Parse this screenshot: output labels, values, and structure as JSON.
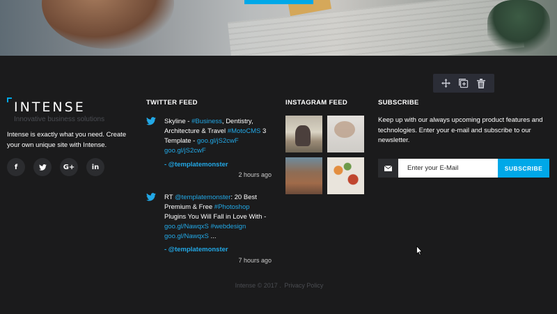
{
  "colors": {
    "accent": "#00a8e8",
    "background": "#1b1b1c",
    "link": "#22a8e6"
  },
  "editor_toolbar": {
    "icons": [
      "move-icon",
      "add-block-icon",
      "trash-icon"
    ]
  },
  "brand": {
    "logo": "INTENSE",
    "tagline": "Innovative business solutions",
    "about": "Intense is exactly what you need. Create your own unique site with Intense."
  },
  "socials": [
    {
      "icon": "facebook-icon",
      "glyph": "f"
    },
    {
      "icon": "twitter-icon",
      "glyph": "t"
    },
    {
      "icon": "google-plus-icon",
      "glyph": "G+"
    },
    {
      "icon": "linkedin-icon",
      "glyph": "in"
    }
  ],
  "twitter": {
    "title": "TWITTER FEED",
    "tweets": [
      {
        "parts": [
          "Skyline - ",
          "#Business",
          ", Dentistry, Architecture & Travel ",
          "#MotoCMS",
          " 3 Template - ",
          "goo.gl/jS2cwF",
          " ",
          "goo.gl/jS2cwF"
        ],
        "author": "- @templatemonster",
        "time": "2 hours ago"
      },
      {
        "parts": [
          "RT ",
          "@templatemonster",
          ": 20 Best Premium & Free ",
          "#Photoshop",
          " Plugins You Will Fall in Love With - ",
          "goo.gl/NawqxS",
          " ",
          "#webdesign",
          " ",
          "goo.gl/NawqxS",
          " ..."
        ],
        "author": "- @templatemonster",
        "time": "7 hours ago"
      }
    ]
  },
  "instagram": {
    "title": "INSTAGRAM FEED"
  },
  "subscribe": {
    "title": "SUBSCRIBE",
    "text": "Keep up with our always upcoming product features and technologies. Enter your e-mail and subscribe to our newsletter.",
    "placeholder": "Enter your E-Mail",
    "button": "SUBSCRIBE"
  },
  "footer": {
    "copyright": "Intense © 2017 .",
    "privacy": "Privacy Policy"
  }
}
